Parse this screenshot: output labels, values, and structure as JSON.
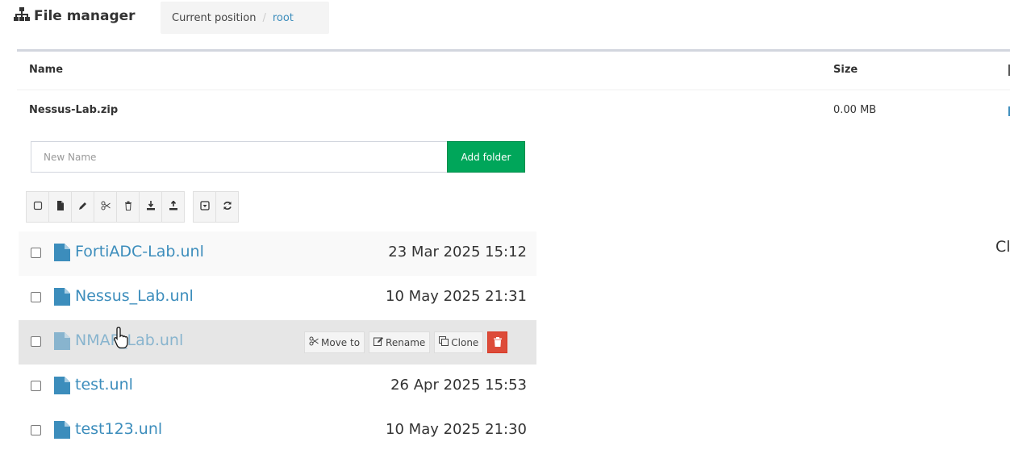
{
  "header": {
    "title": "File manager",
    "title_icon": "sitemap-icon",
    "breadcrumb_label": "Current position",
    "breadcrumb_separator": "/",
    "breadcrumb_current": "root"
  },
  "table": {
    "columns": {
      "name": "Name",
      "size": "Size"
    },
    "rows": [
      {
        "name": "Nessus-Lab.zip",
        "size": "0.00 MB"
      }
    ]
  },
  "new_folder": {
    "placeholder": "New Name",
    "value": "",
    "button_label": "Add folder"
  },
  "toolbar": {
    "icons": [
      "checkbox-icon",
      "file-icon",
      "pencil-icon",
      "scissors-icon",
      "trash-icon",
      "download-icon",
      "upload-icon",
      "dropdown-icon",
      "refresh-icon"
    ]
  },
  "files": [
    {
      "name": "FortiADC-Lab.unl",
      "date": "23 Mar 2025 15:12"
    },
    {
      "name": "Nessus_Lab.unl",
      "date": "10 May 2025 21:31"
    },
    {
      "name": "NMAP_Lab.unl",
      "date": ""
    },
    {
      "name": "test.unl",
      "date": "26 Apr 2025 15:53"
    },
    {
      "name": "test123.unl",
      "date": "10 May 2025 21:30"
    }
  ],
  "row_actions": {
    "move_label": "Move to",
    "rename_label": "Rename",
    "clone_label": "Clone"
  },
  "side_text": "Cl",
  "colors": {
    "link": "#3c8dbc",
    "success": "#00a65a",
    "danger": "#dd4b39",
    "hover_row": "#e6e6e6"
  }
}
